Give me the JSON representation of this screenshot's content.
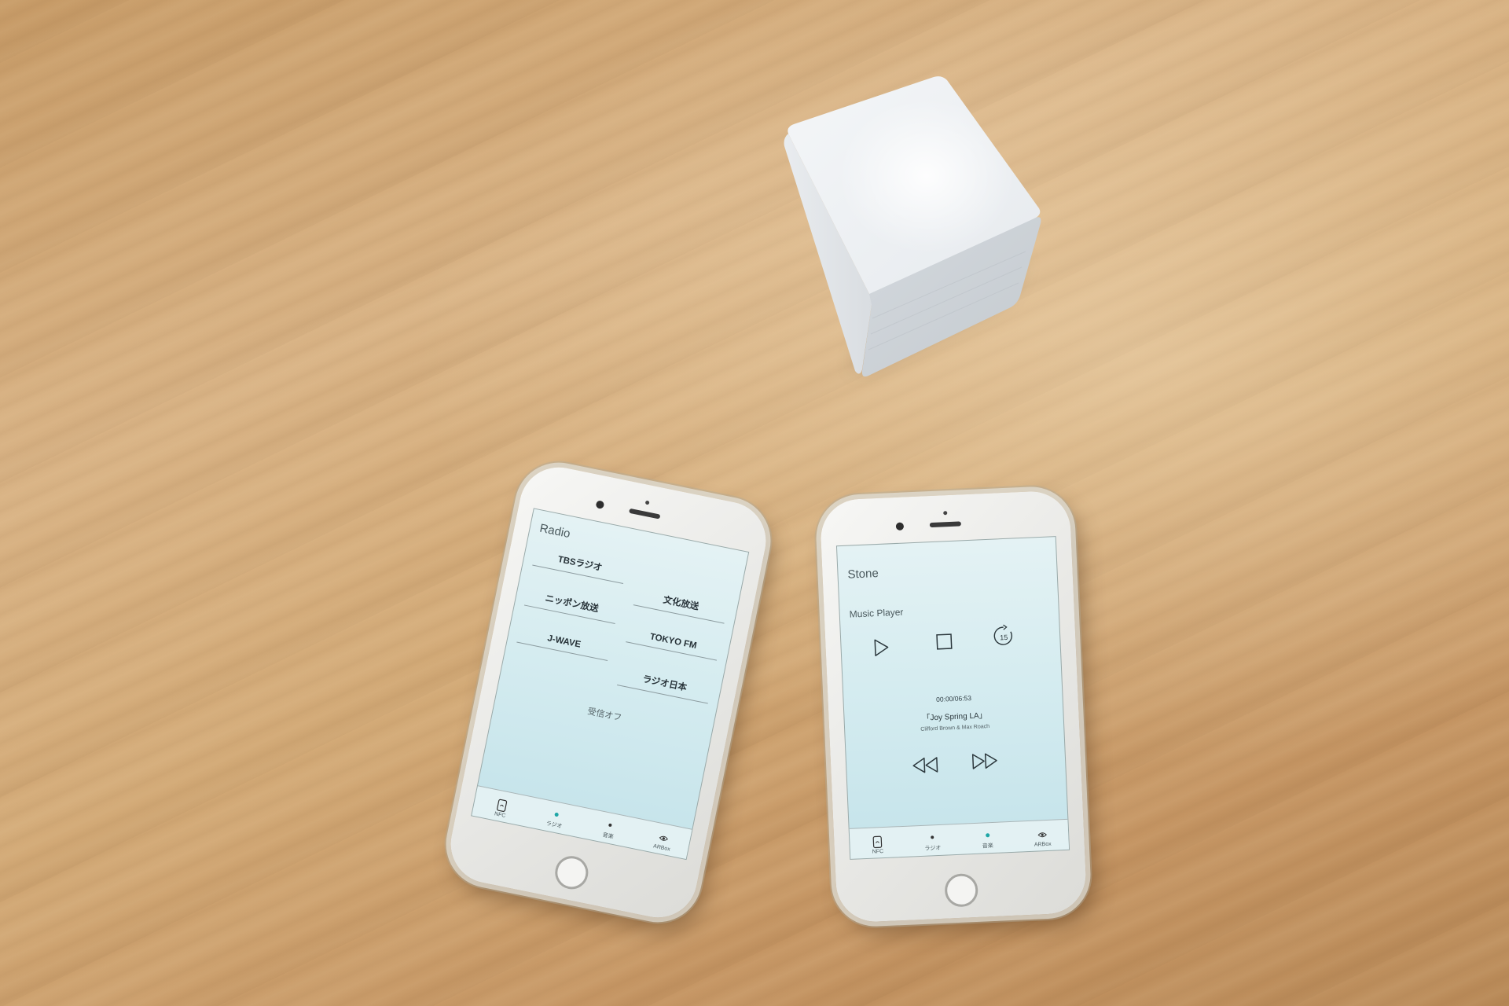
{
  "radio_phone": {
    "title": "Radio",
    "stations": [
      "TBSラジオ",
      "文化放送",
      "ニッポン放送",
      "TOKYO FM",
      "J-WAVE",
      "ラジオ日本"
    ],
    "reception_off": "受信オフ",
    "tabs": [
      {
        "label": "NFC",
        "icon": "nfc-phone-icon"
      },
      {
        "label": "ラジオ",
        "icon": "dot-active-icon"
      },
      {
        "label": "音楽",
        "icon": "dot-icon"
      },
      {
        "label": "ARBox",
        "icon": "eye-icon"
      }
    ]
  },
  "music_phone": {
    "title": "Stone",
    "section": "Music Player",
    "time": "00:00/06:53",
    "track": "「Joy Spring LA」",
    "artist": "Clifford Brown & Max Roach",
    "skip_label": "15",
    "tabs": [
      {
        "label": "NFC",
        "icon": "nfc-phone-icon"
      },
      {
        "label": "ラジオ",
        "icon": "dot-icon"
      },
      {
        "label": "音楽",
        "icon": "dot-active-icon"
      },
      {
        "label": "ARBox",
        "icon": "eye-icon"
      }
    ]
  },
  "colors": {
    "active_tab": "#1fa6a6",
    "screen": "#d5ecf0",
    "wood": "#d2a976",
    "cube": "#eef0f2"
  }
}
